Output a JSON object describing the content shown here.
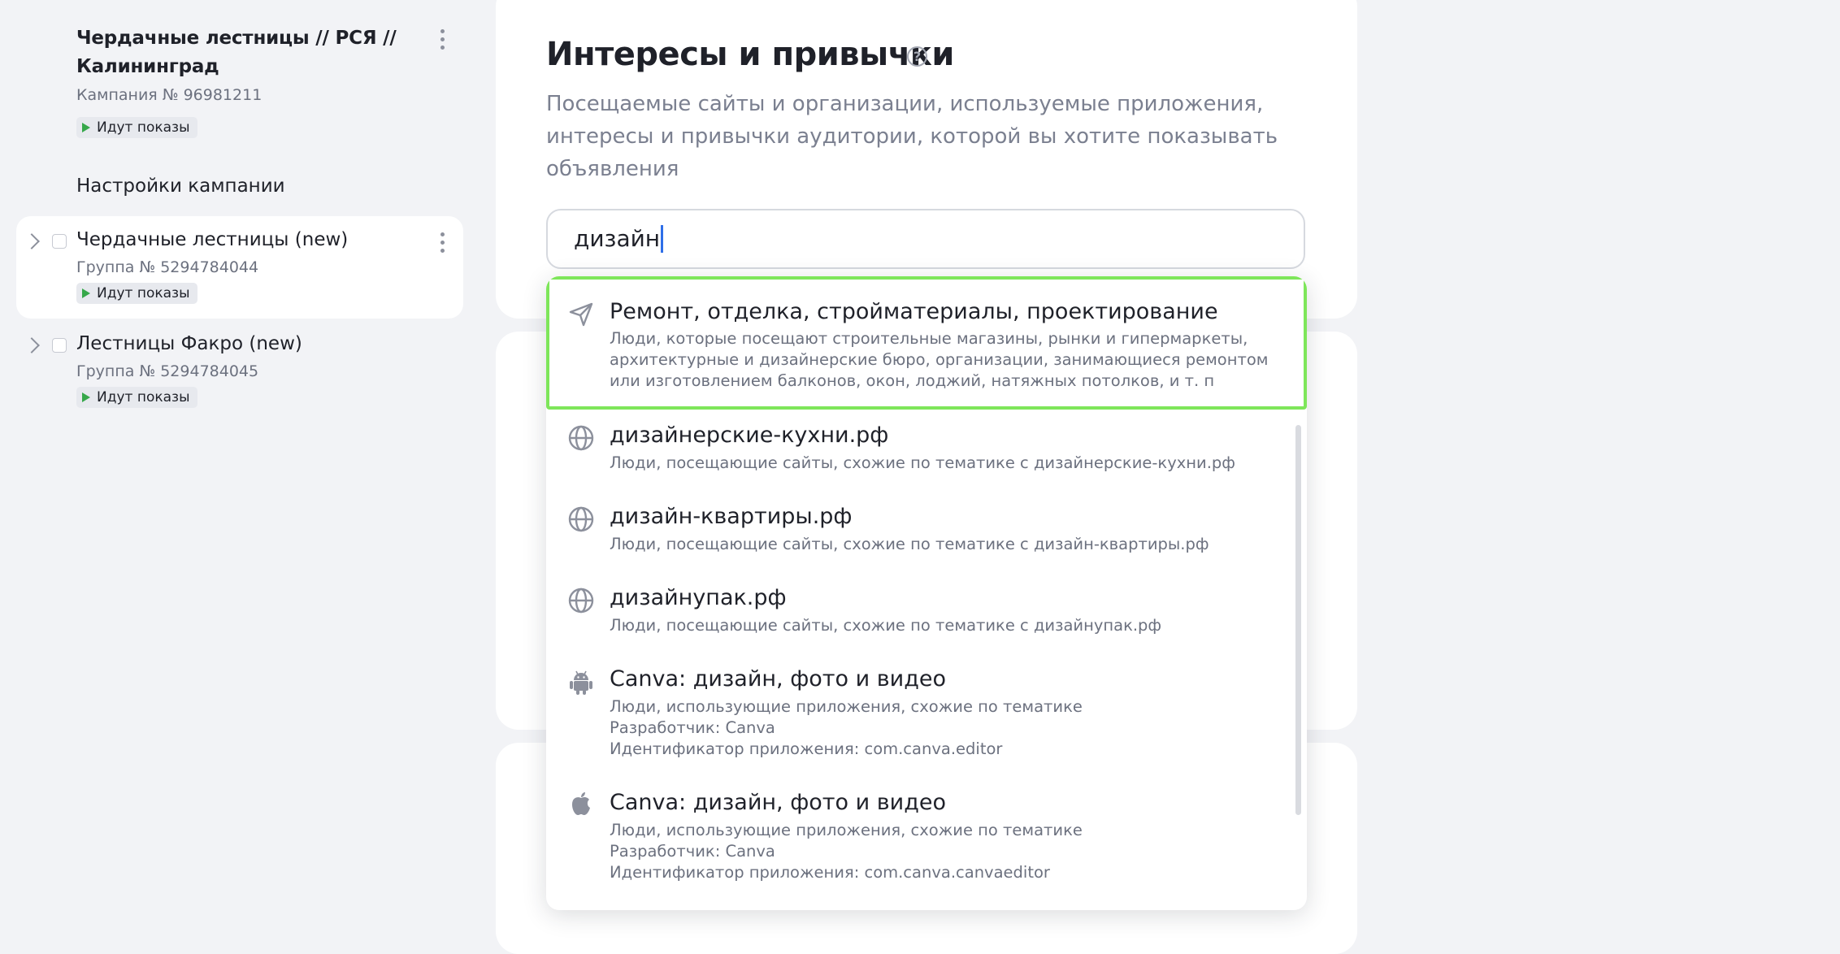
{
  "sidebar": {
    "campaign": {
      "title": "Чердачные лестницы // РСЯ // Калининград",
      "number": "Кампания № 96981211",
      "status": "Идут показы"
    },
    "settings_label": "Настройки кампании",
    "groups": [
      {
        "name": "Чердачные лестницы (new)",
        "number": "Группа № 5294784044",
        "status": "Идут показы",
        "selected": true
      },
      {
        "name": "Лестницы Факро (new)",
        "number": "Группа № 5294784045",
        "status": "Идут показы",
        "selected": false
      }
    ]
  },
  "interests": {
    "title": "Интересы и привычки",
    "help_icon": "?",
    "description": "Посещаемые сайты и организации, используемые приложения, интересы и привычки аудитории, которой вы хотите показывать объявления",
    "search_value": "дизайн"
  },
  "dropdown": {
    "items": [
      {
        "icon": "navigation-arrow-icon",
        "title": "Ремонт, отделка, стройматериалы, проектирование",
        "desc": "Люди, которые посещают строительные магазины, рынки и гипермаркеты, архитектурные и дизайнерские бюро, организации, занимающиеся ремонтом или изготовлением балконов, окон, лоджий, натяжных потолков, и т. п"
      },
      {
        "icon": "globe-icon",
        "title": "дизайнерские-кухни.рф",
        "desc": "Люди, посещающие сайты, схожие по тематике с дизайнерские-кухни.рф"
      },
      {
        "icon": "globe-icon",
        "title": "дизайн-квартиры.рф",
        "desc": "Люди, посещающие сайты, схожие по тематике с дизайн-квартиры.рф"
      },
      {
        "icon": "globe-icon",
        "title": "дизайнупак.рф",
        "desc": "Люди, посещающие сайты, схожие по тематике с дизайнупак.рф"
      },
      {
        "icon": "android-icon",
        "title": "Canva: дизайн, фото и видео",
        "desc": "Люди, использующие приложения, схожие по тематике",
        "developer": "Разработчик: Canva",
        "app_id": "Идентификатор приложения: com.canva.editor"
      },
      {
        "icon": "apple-icon",
        "title": "Canva: дизайн, фото и видео",
        "desc": "Люди, использующие приложения, схожие по тематике",
        "developer": "Разработчик: Canva",
        "app_id": "Идентификатор приложения: com.canva.canvaeditor"
      }
    ]
  },
  "colors": {
    "highlight_outline": "#7ee65a",
    "status_green": "#36a84a",
    "caret_blue": "#2f6fe8"
  }
}
